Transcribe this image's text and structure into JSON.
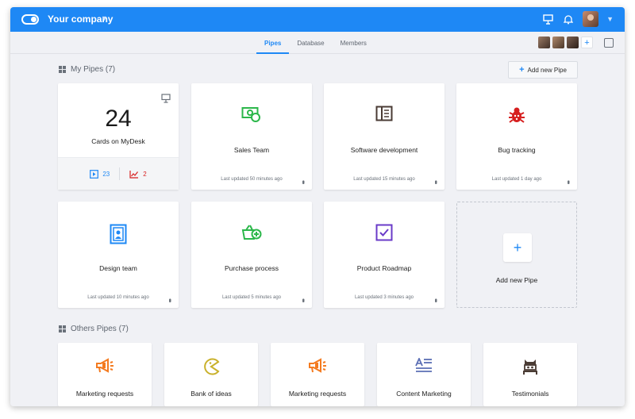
{
  "header": {
    "company": "Your company",
    "accent": "#1e88f5"
  },
  "tabs": [
    {
      "label": "Pipes",
      "active": true
    },
    {
      "label": "Database",
      "active": false
    },
    {
      "label": "Members",
      "active": false
    }
  ],
  "my_pipes": {
    "title": "My Pipes (7)",
    "add_button": "Add new Pipe",
    "desk": {
      "count": "24",
      "label": "Cards on MyDesk",
      "stat_tasks": "23",
      "stat_late": "2"
    },
    "pipes": [
      {
        "name": "Sales Team",
        "updated": "Last updated 50 minutes ago",
        "icon": "money-icon",
        "color": "#2bb74a"
      },
      {
        "name": "Software development",
        "updated": "Last updated 15 minutes ago",
        "icon": "panel-icon",
        "color": "#4a3b34"
      },
      {
        "name": "Bug tracking",
        "updated": "Last updated 1 day ago",
        "icon": "bug-icon",
        "color": "#d61f1f"
      },
      {
        "name": "Design team",
        "updated": "Last updated 10 minutes ago",
        "icon": "portrait-icon",
        "color": "#1e88f5"
      },
      {
        "name": "Purchase process",
        "updated": "Last updated 5 minutes ago",
        "icon": "basket-icon",
        "color": "#2bb74a"
      },
      {
        "name": "Product Roadmap",
        "updated": "Last updated 3 minutes ago",
        "icon": "checkbox-icon",
        "color": "#6a3bc8"
      }
    ],
    "add_card_label": "Add new Pipe"
  },
  "others": {
    "title": "Others Pipes (7)",
    "pipes": [
      {
        "name": "Marketing requests",
        "icon": "megaphone-icon",
        "color": "#f47b20"
      },
      {
        "name": "Bank of ideas",
        "icon": "pacman-icon",
        "color": "#c9b12b"
      },
      {
        "name": "Marketing requests",
        "icon": "megaphone-icon",
        "color": "#f47b20"
      },
      {
        "name": "Content Marketing",
        "icon": "text-align-icon",
        "color": "#5b6fb5"
      },
      {
        "name": "Testimonials",
        "icon": "mask-icon",
        "color": "#4a3b34"
      }
    ]
  }
}
